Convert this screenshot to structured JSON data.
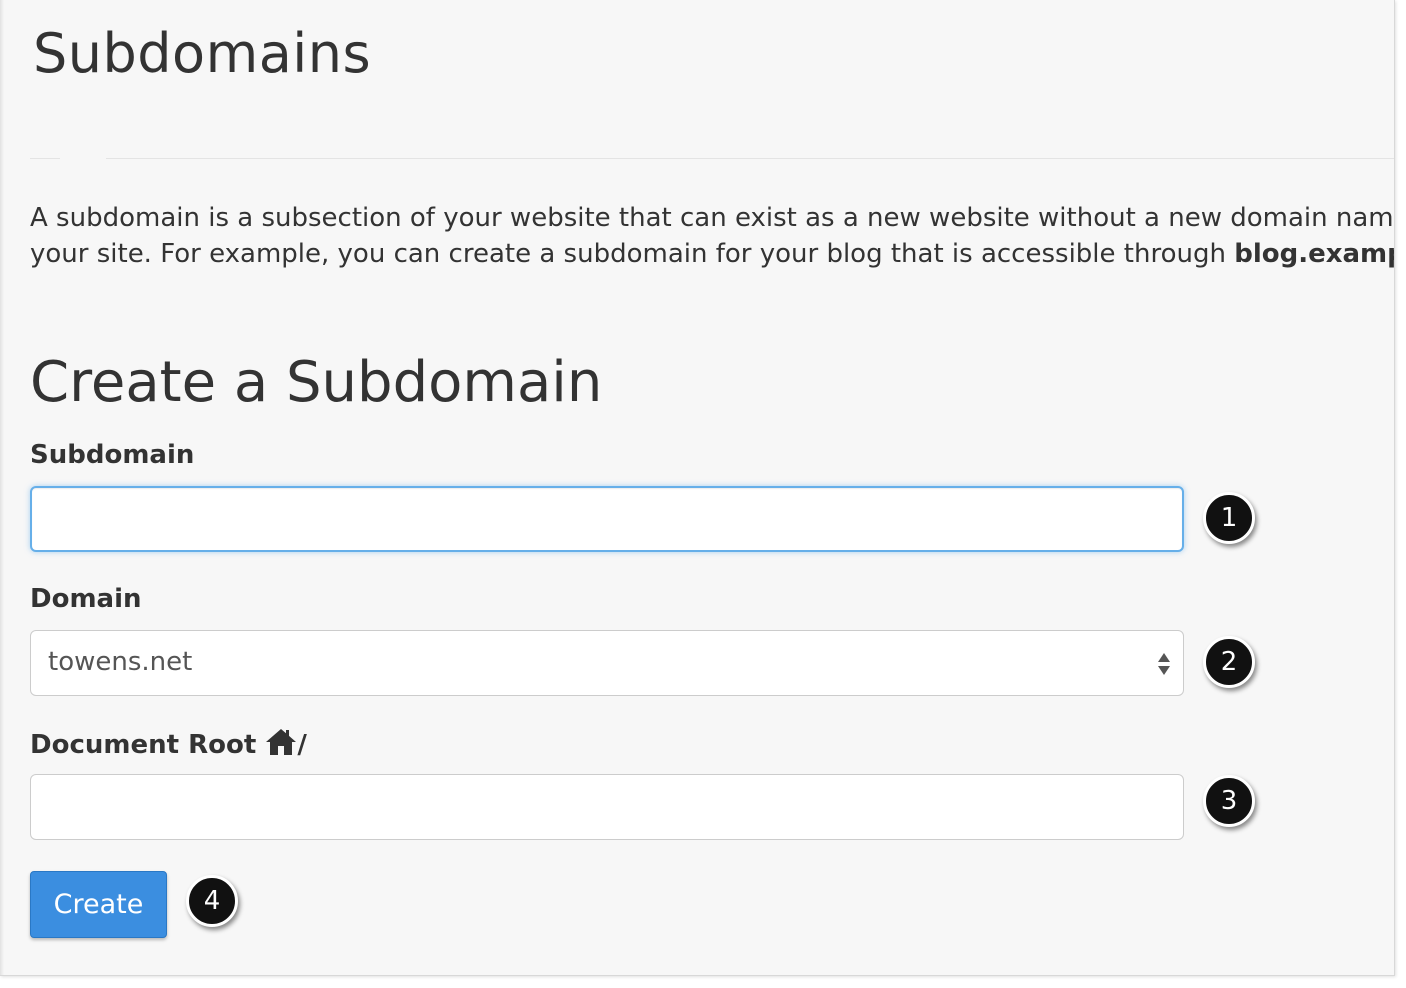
{
  "header": {
    "title": "Subdomains"
  },
  "description": {
    "line1": "A subdomain is a subsection of your website that can exist as a new website without a new domain name",
    "line2_prefix": "your site. For example, you can create a subdomain for your blog that is accessible through ",
    "line2_bold": "blog.example.com"
  },
  "form": {
    "title": "Create a Subdomain",
    "subdomain": {
      "label": "Subdomain",
      "value": "",
      "marker": "1"
    },
    "domain": {
      "label": "Domain",
      "selected": "towens.net",
      "marker": "2"
    },
    "document_root": {
      "label": "Document Root",
      "suffix": "/",
      "icon": "home-icon",
      "value": "",
      "marker": "3"
    },
    "create_button": {
      "label": "Create",
      "marker": "4"
    }
  },
  "colors": {
    "background": "#f7f7f7",
    "text": "#333333",
    "focus_border": "#66afe9",
    "button": "#3b8ee0",
    "marker": "#111111"
  }
}
